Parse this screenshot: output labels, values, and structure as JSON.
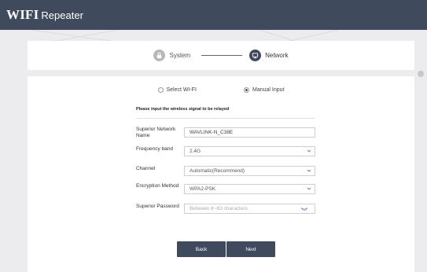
{
  "header": {
    "brand": "WIFI",
    "product": "Repeater"
  },
  "stepper": {
    "steps": [
      {
        "label": "System",
        "icon": "lock-icon",
        "state": "inactive"
      },
      {
        "label": "Network",
        "icon": "network-icon",
        "state": "active"
      }
    ]
  },
  "mode": {
    "options": [
      {
        "label": "Select WI-FI",
        "selected": false
      },
      {
        "label": "Manual Input",
        "selected": true
      }
    ]
  },
  "form": {
    "instruction": "Please input the wireless signal to be relayed",
    "network_name": {
      "label": "Superior Network Name",
      "value": "WAVLINK-N_C38E"
    },
    "frequency_band": {
      "label": "Frequency band",
      "value": "2.4G"
    },
    "channel": {
      "label": "Channel",
      "value": "Automatic(Recommend)"
    },
    "encryption": {
      "label": "Encryption Method",
      "value": "WPA2-PSK"
    },
    "password": {
      "label": "Superior Password",
      "placeholder": "Between 8~63 characters",
      "value": ""
    }
  },
  "buttons": {
    "back": "Back",
    "next": "Next"
  },
  "colors": {
    "header": "#3f4a5c",
    "button": "#3f4a5c",
    "background": "#ececef"
  }
}
